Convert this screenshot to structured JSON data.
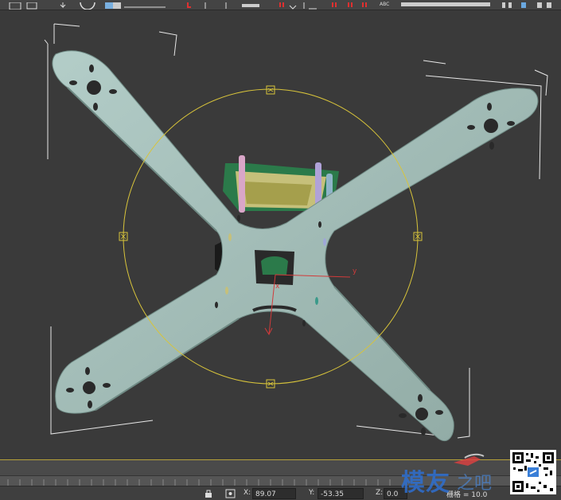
{
  "status": {
    "x_label": "X:",
    "x_value": "89.07",
    "y_label": "Y:",
    "y_value": "-53.35",
    "z_label": "Z:",
    "z_value": "0.0",
    "grid_label": "栅格 = 10.0"
  },
  "viewport": {
    "axis_y_label": "y",
    "axis_x_label": "x"
  },
  "watermark": {
    "text": "模友",
    "sub": "之吧"
  },
  "toolbar": {
    "abc_label": "ABC"
  },
  "colors": {
    "frame": "#9db8b2",
    "gizmo": "#d8c43a",
    "background": "#3a3a3a",
    "axis": "#d23a3a"
  }
}
